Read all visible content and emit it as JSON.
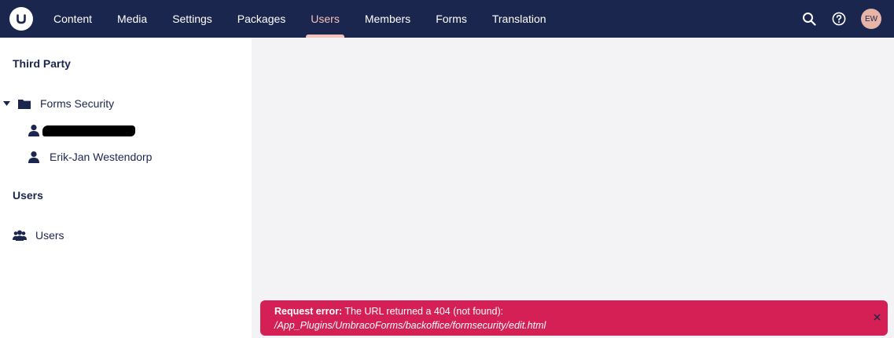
{
  "nav": {
    "items": [
      {
        "label": "Content",
        "active": false
      },
      {
        "label": "Media",
        "active": false
      },
      {
        "label": "Settings",
        "active": false
      },
      {
        "label": "Packages",
        "active": false
      },
      {
        "label": "Users",
        "active": true
      },
      {
        "label": "Members",
        "active": false
      },
      {
        "label": "Forms",
        "active": false
      },
      {
        "label": "Translation",
        "active": false
      }
    ],
    "avatar_initials": "EW",
    "active_color": "#f5c1bc",
    "bar_color": "#1b264f"
  },
  "sidebar": {
    "section_third_party": "Third Party",
    "forms_security_label": "Forms Security",
    "user_2_label": "Erik-Jan Westendorp",
    "section_users": "Users",
    "users_item_label": "Users"
  },
  "notification": {
    "prefix": "Request error:",
    "message": " The URL returned a 404 (not found):",
    "path": "/App_Plugins/UmbracoForms/backoffice/formsecurity/edit.html",
    "color": "#d42054"
  }
}
